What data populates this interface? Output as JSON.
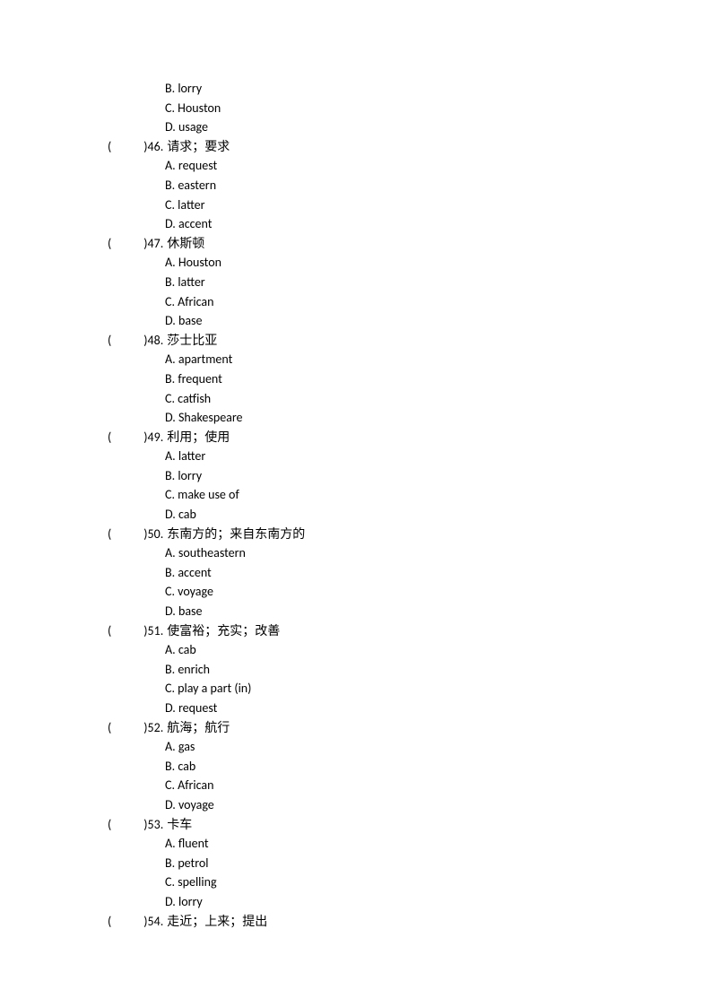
{
  "orphan_options": [
    "B. lorry",
    "C. Houston",
    "D. usage"
  ],
  "questions": [
    {
      "number": "46.",
      "prompt": " 请求；要求",
      "options": [
        "A. request",
        "B. eastern",
        "C. latter",
        "D. accent"
      ]
    },
    {
      "number": "47.",
      "prompt": " 休斯顿",
      "options": [
        "A. Houston",
        "B. latter",
        "C. African",
        "D. base"
      ]
    },
    {
      "number": "48.",
      "prompt": "莎士比亚",
      "options": [
        "A. apartment",
        "B. frequent",
        "C. catfish",
        "D. Shakespeare"
      ]
    },
    {
      "number": "49.",
      "prompt": " 利用；使用",
      "options": [
        "A. latter",
        "B. lorry",
        "C. make use of",
        "D. cab"
      ]
    },
    {
      "number": "50.",
      "prompt": "  东南方的；来自东南方的",
      "options": [
        "A. southeastern",
        "B. accent",
        "C. voyage",
        "D. base"
      ]
    },
    {
      "number": "51.",
      "prompt": "使富裕；充实；改善",
      "options": [
        "A. cab",
        "B. enrich",
        "C. play a part (in)",
        "D. request"
      ]
    },
    {
      "number": "52.",
      "prompt": " 航海；航行",
      "options": [
        "A. gas",
        "B. cab",
        "C. African",
        "D. voyage"
      ]
    },
    {
      "number": "53.",
      "prompt": "  卡车",
      "options": [
        "A. fluent",
        "B. petrol",
        "C. spelling",
        "D. lorry"
      ]
    },
    {
      "number": "54.",
      "prompt": "走近；上来；提出",
      "options": []
    }
  ]
}
